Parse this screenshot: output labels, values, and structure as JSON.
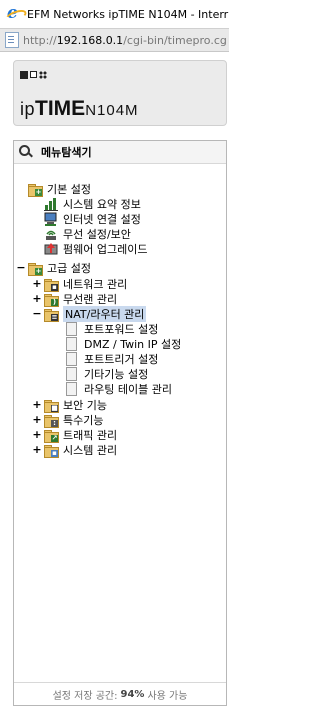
{
  "window": {
    "title": "EFM Networks ipTIME N104M - Interr"
  },
  "address": {
    "url_prefix": "http://",
    "host": "192.168.0.1",
    "path": "/cgi-bin/timepro.cg"
  },
  "brand": {
    "prefix": "ip",
    "time": "TIME",
    "model": "N104M"
  },
  "menu": {
    "title": "메뉴탐색기",
    "basic": {
      "label": "기본 설정",
      "items": [
        "시스템 요약 정보",
        "인터넷 연결 설정",
        "무선 설정/보안",
        "펌웨어 업그레이드"
      ]
    },
    "advanced": {
      "toggle": "−",
      "label": "고급 설정",
      "groups": [
        {
          "toggle": "+",
          "label": "네트워크 관리"
        },
        {
          "toggle": "+",
          "label": "무선랜 관리"
        },
        {
          "toggle": "−",
          "label": "NAT/라우터 관리"
        },
        {
          "toggle": "+",
          "label": "보안 기능"
        },
        {
          "toggle": "+",
          "label": "특수기능"
        },
        {
          "toggle": "+",
          "label": "트래픽 관리"
        },
        {
          "toggle": "+",
          "label": "시스템 관리"
        }
      ],
      "nat_items": [
        "포트포워드 설정",
        "DMZ / Twin IP 설정",
        "포트트리거 설정",
        "기타기능 설정",
        "라우팅 테이블 관리"
      ]
    },
    "footer": {
      "prefix": "설정 저장 공간:",
      "value": "94%",
      "suffix": "사용 가능"
    }
  }
}
